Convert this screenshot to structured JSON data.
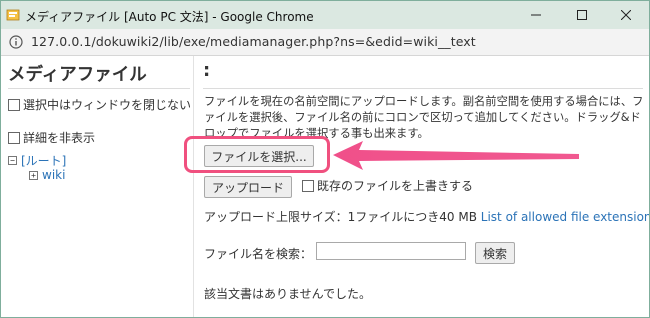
{
  "window": {
    "title": "メディアファイル [Auto PC 文法] - Google Chrome",
    "url": "127.0.0.1/dokuwiki2/lib/exe/mediamanager.php?ns=&edid=wiki__text"
  },
  "sidebar": {
    "heading": "メディアファイル",
    "options": [
      {
        "label": "選択中はウィンドウを閉じない"
      },
      {
        "label": "詳細を非表示"
      }
    ],
    "tree": {
      "root": "[ルート]",
      "child": "wiki"
    }
  },
  "main": {
    "heading": ":",
    "description": "ファイルを現在の名前空間にアップロードします。副名前空間を使用する場合には、ファイルを選択後、ファイル名の前にコロンで区切って追加してください。ドラッグ&ドロップでファイルを選択する事も出来ます。",
    "choose_file_label": "ファイルを選択...",
    "upload_label": "アップロード",
    "overwrite_label": "既存のファイルを上書きする",
    "upload_limit": "アップロード上限サイズ：1ファイルにつき40 MB",
    "allowed_link": "List of allowed file extensions",
    "search_label": "ファイル名を検索：",
    "search_value": "",
    "search_button": "検索",
    "no_results": "該当文書はありませんでした。"
  },
  "colors": {
    "titlebar": "#dbe8e1",
    "highlight": "#f0507f",
    "link": "#2b73b7"
  }
}
